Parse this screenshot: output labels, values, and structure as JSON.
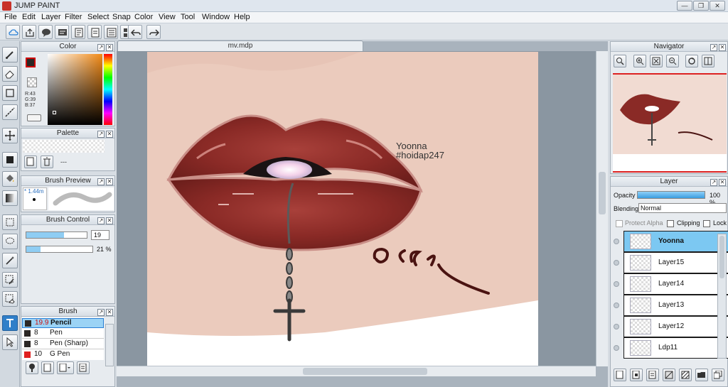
{
  "window": {
    "title": "JUMP PAINT",
    "minimize": "—",
    "restore": "❐",
    "close": "✕"
  },
  "menu": [
    "File",
    "Edit",
    "Layer",
    "Filter",
    "Select",
    "Snap",
    "Color",
    "View",
    "Tool",
    "Window",
    "Help"
  ],
  "document": {
    "tab_label": "mv.mdp"
  },
  "color_panel": {
    "title": "Color",
    "r": "R:43",
    "g": "G:39",
    "b": "B:37",
    "fg_color": "#2b2725"
  },
  "palette_panel": {
    "title": "Palette",
    "dash": "---"
  },
  "brush_preview_panel": {
    "title": "Brush Preview",
    "size_label": "* 1.44m"
  },
  "brush_control_panel": {
    "title": "Brush Control",
    "size_value": "19",
    "opacity_value": "21 %",
    "size_fill": 0.62,
    "opacity_fill": 0.21
  },
  "brush_panel": {
    "title": "Brush",
    "items": [
      {
        "size": "19.9",
        "name": "Pencil",
        "color": "#2b2725",
        "selected": true
      },
      {
        "size": "8",
        "name": "Pen",
        "color": "#2b2725",
        "selected": false
      },
      {
        "size": "8",
        "name": "Pen (Sharp)",
        "color": "#2b2725",
        "selected": false
      },
      {
        "size": "10",
        "name": "G Pen",
        "color": "#e02020",
        "selected": false
      }
    ]
  },
  "navigator_panel": {
    "title": "Navigator"
  },
  "layer_panel": {
    "title": "Layer",
    "opacity_label": "Opacity",
    "opacity_value": "100 %",
    "blending_label": "Blending",
    "blending_value": "Normal",
    "protect_alpha": "Protect Alpha",
    "clipping": "Clipping",
    "lock": "Lock",
    "layers": [
      {
        "name": "Yoonna",
        "selected": true
      },
      {
        "name": "Layer15",
        "selected": false
      },
      {
        "name": "Layer14",
        "selected": false
      },
      {
        "name": "Layer13",
        "selected": false
      },
      {
        "name": "Layer12",
        "selected": false
      },
      {
        "name": "Ldp11",
        "selected": false
      }
    ]
  },
  "artwork": {
    "text_name": "Yoonna",
    "text_handle": "#hoidap247",
    "signature": "@Eak",
    "lip_color": "#8a2a26",
    "skin_color": "#ebcbbd"
  }
}
